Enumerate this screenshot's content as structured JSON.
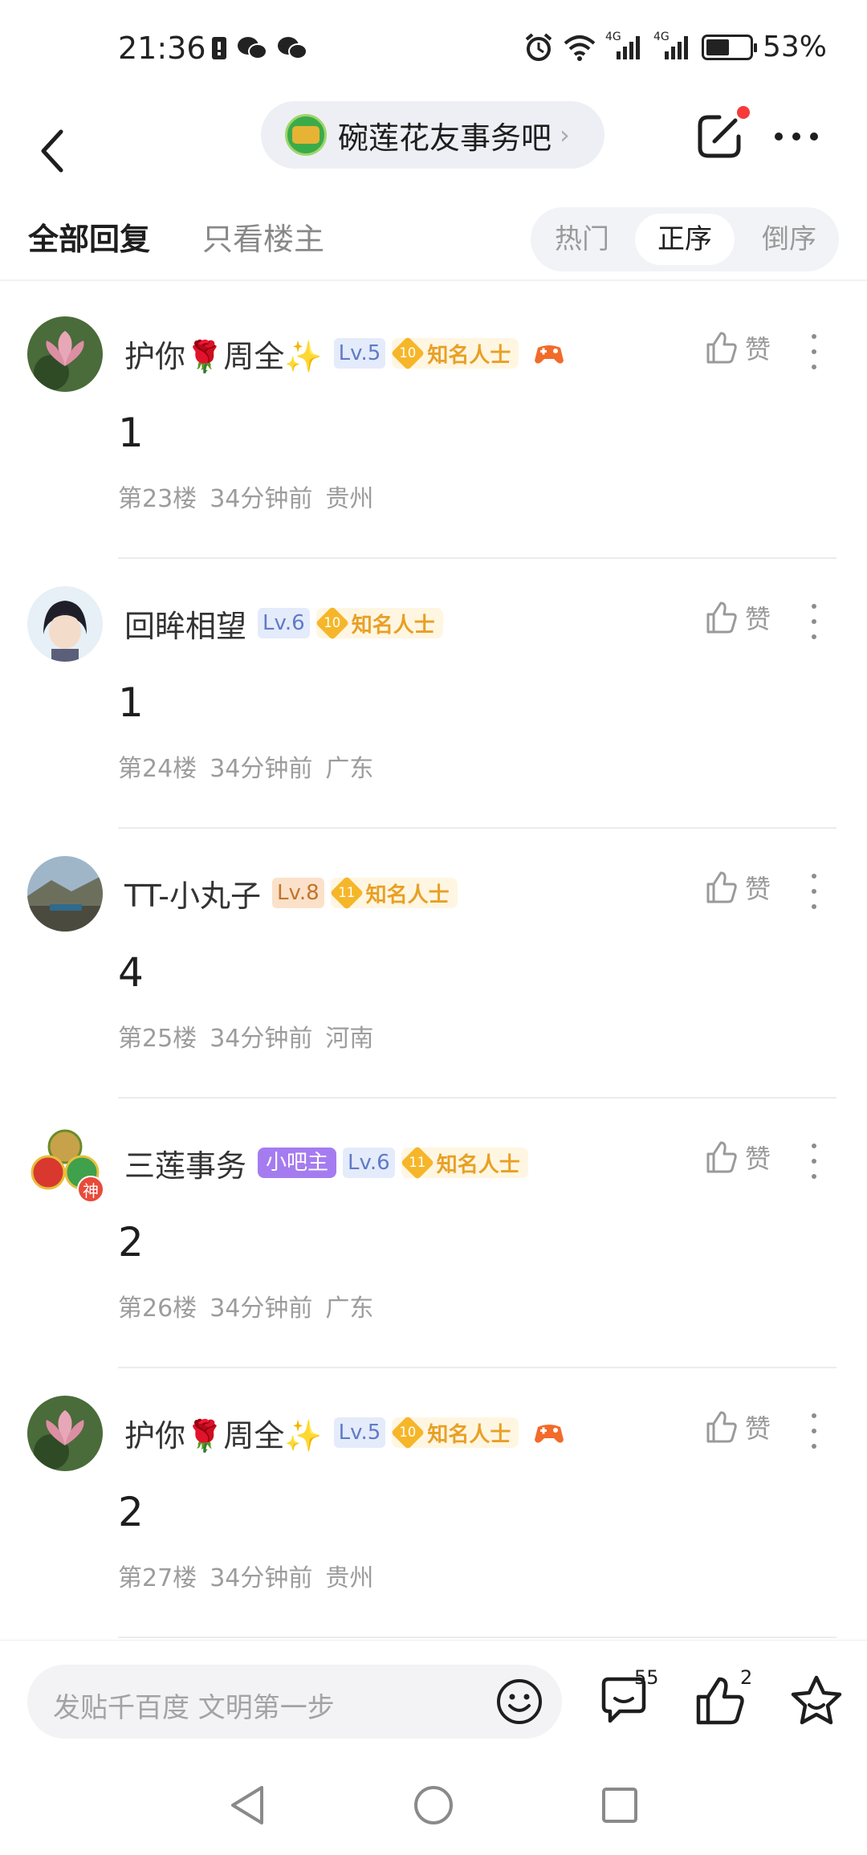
{
  "status_bar": {
    "time": "21:36",
    "battery": "53%",
    "battery_level": 0.53,
    "network_labels": [
      "4G",
      "4G"
    ]
  },
  "header": {
    "forum_name": "碗莲花友事务吧",
    "forum_chevron": "›"
  },
  "tabs": {
    "all_replies": "全部回复",
    "owner_only": "只看楼主",
    "sort": {
      "hot": "热门",
      "asc": "正序",
      "desc": "倒序"
    }
  },
  "replies": [
    {
      "username": "护你🌹周全✨",
      "level": "Lv.5",
      "badge_num": "10",
      "badge_text": "知名人士",
      "content": "1",
      "floor": "第23楼",
      "time": "34分钟前",
      "location": "贵州",
      "like_label": "赞"
    },
    {
      "username": "回眸相望",
      "level": "Lv.6",
      "badge_num": "10",
      "badge_text": "知名人士",
      "content": "1",
      "floor": "第24楼",
      "time": "34分钟前",
      "location": "广东",
      "like_label": "赞"
    },
    {
      "username": "TT-小丸子",
      "level": "Lv.8",
      "badge_num": "11",
      "badge_text": "知名人士",
      "content": "4",
      "floor": "第25楼",
      "time": "34分钟前",
      "location": "河南",
      "like_label": "赞"
    },
    {
      "username": "三莲事务",
      "admin_tag": "小吧主",
      "avatar_mark": "神",
      "level": "Lv.6",
      "badge_num": "11",
      "badge_text": "知名人士",
      "content": "2",
      "floor": "第26楼",
      "time": "34分钟前",
      "location": "广东",
      "like_label": "赞"
    },
    {
      "username": "护你🌹周全✨",
      "level": "Lv.5",
      "badge_num": "10",
      "badge_text": "知名人士",
      "content": "2",
      "floor": "第27楼",
      "time": "34分钟前",
      "location": "贵州",
      "like_label": "赞"
    }
  ],
  "bottom_bar": {
    "placeholder": "发贴千百度 文明第一步",
    "comment_count": "55",
    "like_count": "2"
  },
  "colors": {
    "accent_red": "#f53a3a",
    "badge_gold": "#f6b629",
    "admin_purple": "#a57cf0"
  }
}
